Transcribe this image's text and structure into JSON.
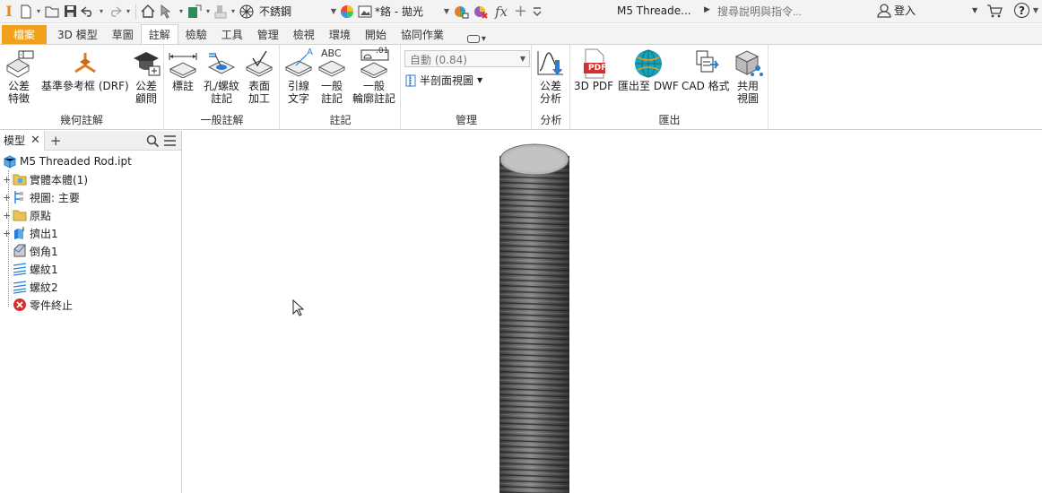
{
  "qat": {
    "material": "不銹鋼",
    "appearance": "*鉻 - 拋光",
    "fx": "fx",
    "doc_title": "M5 Threade...",
    "search_placeholder": "搜尋說明與指令...",
    "signin": "登入",
    "help": "?"
  },
  "tabs": [
    {
      "label": "檔案"
    },
    {
      "label": "3D 模型"
    },
    {
      "label": "草圖"
    },
    {
      "label": "註解"
    },
    {
      "label": "檢驗"
    },
    {
      "label": "工具"
    },
    {
      "label": "管理"
    },
    {
      "label": "檢視"
    },
    {
      "label": "環境"
    },
    {
      "label": "開始"
    },
    {
      "label": "協同作業"
    }
  ],
  "ribbon": {
    "panels": {
      "geometric": "幾何註解",
      "general": "一般註解",
      "notes": "註記",
      "manage": "管理",
      "analysis": "分析",
      "export": "匯出"
    },
    "tools": {
      "tolerance_feature": "公差\n特徵",
      "drf": "基準參考框 (DRF)",
      "tolerance_advisor": "公差\n顧問",
      "dimension": "標註",
      "hole_thread": "孔/螺紋\n註記",
      "surface": "表面\n加工",
      "leader_text": "引線\n文字",
      "general_note": "一般\n註記",
      "profile_note": "一般\n輪廓註記",
      "tolerance_analysis": "公差\n分析",
      "pdf3d": "3D PDF",
      "dwf": "匯出至 DWF",
      "cad_format": "CAD 格式",
      "shared_view": "共用\n視圖"
    },
    "style_select": "自動 (0.84)",
    "section_view": "半剖面視圖",
    "abc": "ABC",
    "a_letter": "A",
    "profile_value": ".01",
    "pdf_text": "PDF"
  },
  "browser": {
    "tab": "模型",
    "plus": "+",
    "items": [
      {
        "label": "M5 Threaded Rod.ipt"
      },
      {
        "label": "實體本體(1)"
      },
      {
        "label": "視圖: 主要"
      },
      {
        "label": "原點"
      },
      {
        "label": "擠出1"
      },
      {
        "label": "倒角1"
      },
      {
        "label": "螺紋1"
      },
      {
        "label": "螺紋2"
      },
      {
        "label": "零件終止"
      }
    ]
  },
  "colors": {
    "file_tab": "#f0a01c",
    "rod_dark": "#3c3c3c",
    "rod_light": "#8a8a8a",
    "rod_top": "#b8b8b8",
    "end_red": "#d62f2f",
    "folder": "#e8c456",
    "icon_blue": "#2b7cd3"
  }
}
